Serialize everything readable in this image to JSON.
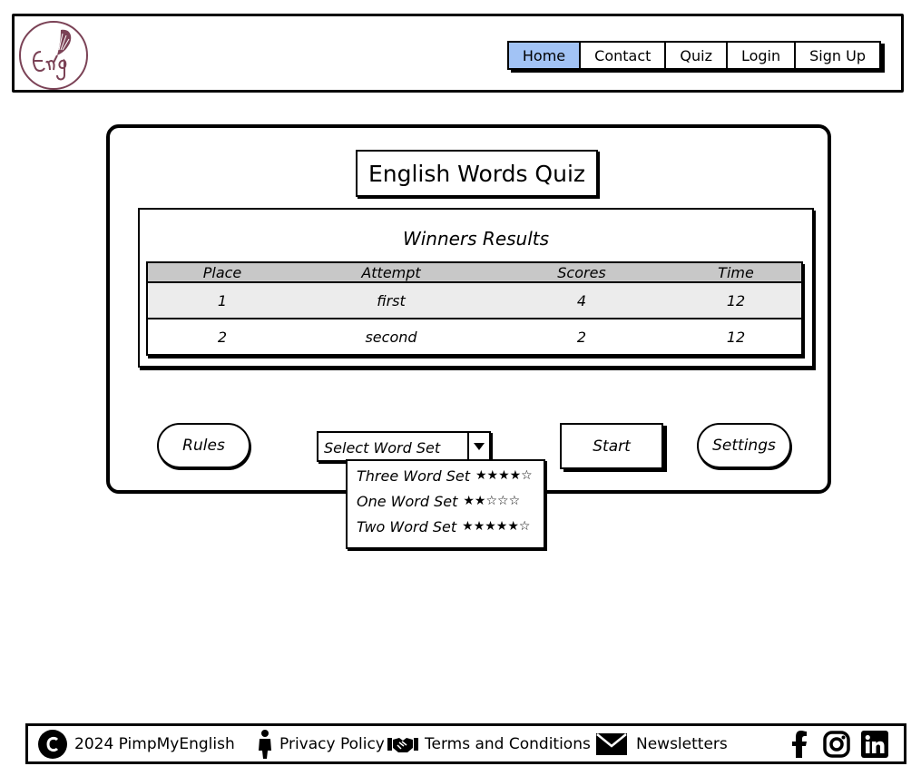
{
  "nav": {
    "items": [
      {
        "label": "Home",
        "active": true
      },
      {
        "label": "Contact",
        "active": false
      },
      {
        "label": "Quiz",
        "active": false
      },
      {
        "label": "Login",
        "active": false
      },
      {
        "label": "Sign Up",
        "active": false
      }
    ],
    "active_color": "#a2c3f5"
  },
  "logo": {
    "color": "#7b4256",
    "icon": "quill-logo"
  },
  "quiz": {
    "title": "English Words Quiz",
    "results_title": "Winners Results",
    "table": {
      "headers": [
        "Place",
        "Attempt",
        "Scores",
        "Time"
      ],
      "rows": [
        [
          "1",
          "first",
          "4",
          "12"
        ],
        [
          "2",
          "second",
          "2",
          "12"
        ]
      ]
    },
    "buttons": {
      "rules": "Rules",
      "start": "Start",
      "settings": "Settings"
    },
    "select": {
      "placeholder": "Select Word Set",
      "options": [
        {
          "label": "Three Word Set",
          "stars": "★★★★☆",
          "rating": 4,
          "max": 5
        },
        {
          "label": "One Word Set",
          "stars": "★★☆☆☆",
          "rating": 2,
          "max": 5
        },
        {
          "label": "Two Word Set",
          "stars": "★★★★★☆",
          "rating": 5,
          "max": 6
        }
      ]
    }
  },
  "footer": {
    "copyright": "2024 PimpMyEnglish",
    "privacy": "Privacy Policy",
    "terms": "Terms and Conditions",
    "newsletters": "Newsletters",
    "social": [
      "facebook-icon",
      "instagram-icon",
      "linkedin-icon"
    ]
  }
}
